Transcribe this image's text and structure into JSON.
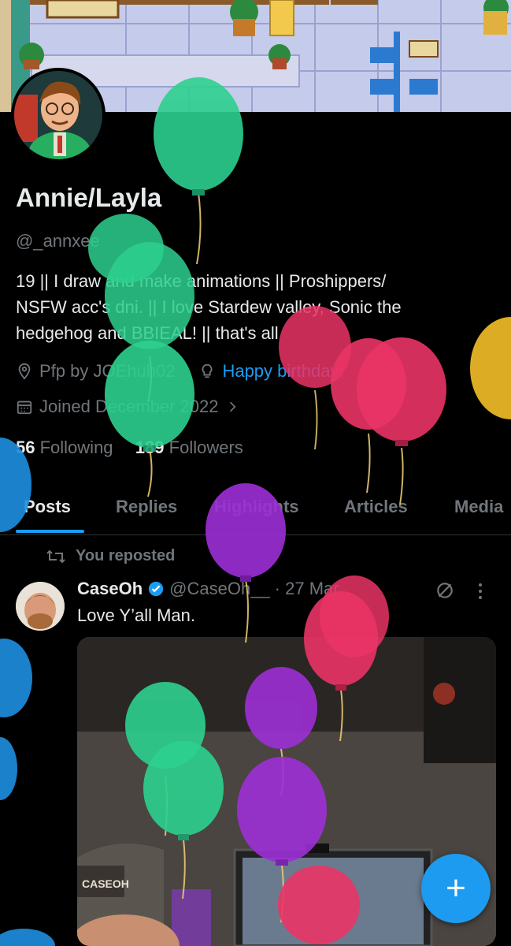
{
  "profile": {
    "name": "Annie/Layla",
    "handle": "@_annxee",
    "bio_line1": "19 || I draw and make animations || Proshippers/",
    "bio_line2": "NSFW acc's dni. || I love Stardew valley, Sonic the",
    "bio_line3": "hedgehog and BBIEAL! || that's all",
    "location": "Pfp by JOEhuh02",
    "website": "Happy birthday!",
    "joined": "Joined December 2022",
    "following_count": "56",
    "following_label": "Following",
    "followers_count": "189",
    "followers_label": "Followers"
  },
  "tabs": [
    "Posts",
    "Replies",
    "Highlights",
    "Articles",
    "Media"
  ],
  "repost_label": "You reposted",
  "tweet": {
    "author": "CaseOh",
    "handle": "@CaseOh__",
    "date": "· 27 Mar",
    "text": "Love Y’all Man.",
    "media_label": "CASEOH"
  },
  "fab_label": "+",
  "colors": {
    "accent": "#1d9bf0",
    "balloon_green": "#2dd08f",
    "balloon_pink": "#ea3466",
    "balloon_purple": "#9d2fd6",
    "balloon_yellow": "#e8b626",
    "balloon_blue": "#1d8fe0"
  },
  "icons": {
    "location": "map-pin-icon",
    "website": "bulb-icon",
    "joined": "calendar-icon",
    "repost": "repost-icon",
    "verified": "verified-badge-icon",
    "grok": "slash-circle-icon",
    "more": "more-dots-icon"
  }
}
